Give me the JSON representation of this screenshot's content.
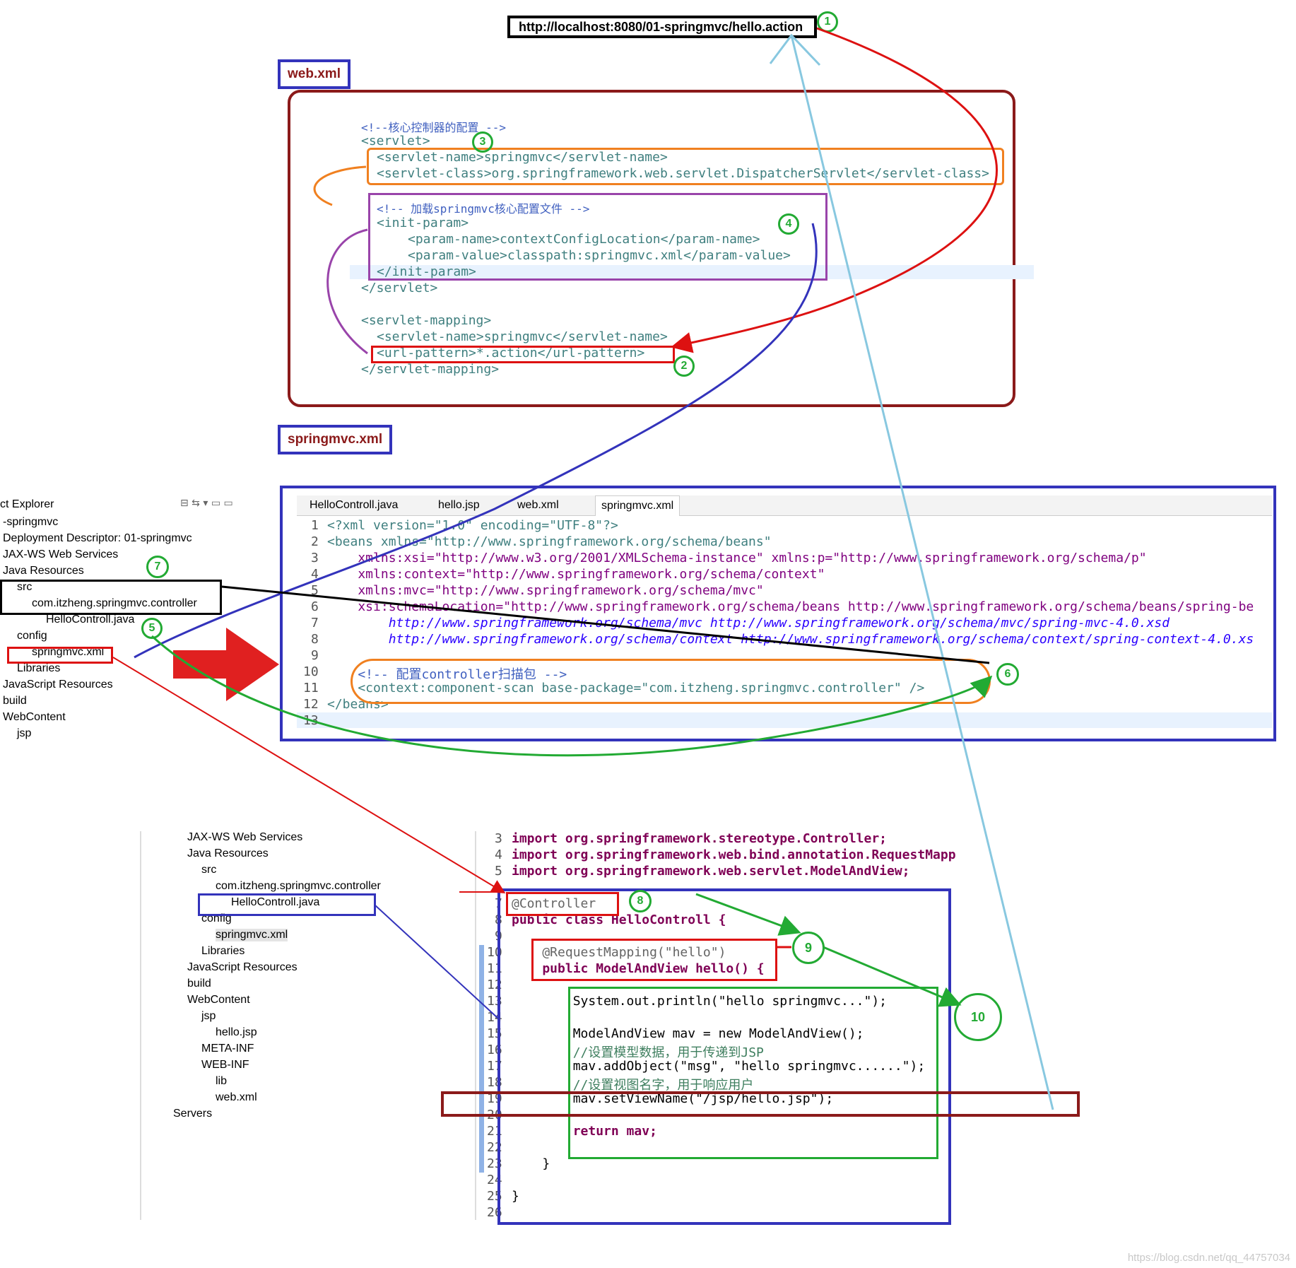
{
  "url": "http://localhost:8080/01-springmvc/hello.action",
  "labels": {
    "webxml": "web.xml",
    "springmvcxml": "springmvc.xml"
  },
  "steps": [
    "1",
    "2",
    "3",
    "4",
    "5",
    "6",
    "7",
    "8",
    "9",
    "10"
  ],
  "webxml_lines": [
    "<!--核心控制器的配置 -->",
    "<servlet>",
    "<servlet-name>springmvc</servlet-name>",
    "<servlet-class>org.springframework.web.servlet.DispatcherServlet</servlet-class>",
    "<!-- 加载springmvc核心配置文件 -->",
    "<init-param>",
    "<param-name>contextConfigLocation</param-name>",
    "<param-value>classpath:springmvc.xml</param-value>",
    "</init-param>",
    "</servlet>",
    "<servlet-mapping>",
    "<servlet-name>springmvc</servlet-name>",
    "<url-pattern>*.action</url-pattern>",
    "</servlet-mapping>"
  ],
  "explorer": {
    "title": "ct Explorer",
    "items": [
      "-springmvc",
      "Deployment Descriptor: 01-springmvc",
      "JAX-WS Web Services",
      "Java Resources",
      "src",
      "com.itzheng.springmvc.controller",
      "HelloControll.java",
      "config",
      "springmvc.xml",
      "Libraries",
      "JavaScript Resources",
      "build",
      "WebContent",
      "jsp"
    ]
  },
  "editor": {
    "tabs": [
      "HelloControll.java",
      "hello.jsp",
      "web.xml",
      "springmvc.xml"
    ],
    "line_numbers": [
      "1",
      "2",
      "3",
      "4",
      "5",
      "6",
      "7",
      "8",
      "9",
      "10",
      "11",
      "12",
      "13"
    ],
    "lines": [
      "<?xml version=\"1.0\" encoding=\"UTF-8\"?>",
      "<beans xmlns=\"http://www.springframework.org/schema/beans\"",
      "    xmlns:xsi=\"http://www.w3.org/2001/XMLSchema-instance\" xmlns:p=\"http://www.springframework.org/schema/p\"",
      "    xmlns:context=\"http://www.springframework.org/schema/context\"",
      "    xmlns:mvc=\"http://www.springframework.org/schema/mvc\"",
      "    xsi:schemaLocation=\"http://www.springframework.org/schema/beans http://www.springframework.org/schema/beans/spring-be",
      "        http://www.springframework.org/schema/mvc http://www.springframework.org/schema/mvc/spring-mvc-4.0.xsd",
      "        http://www.springframework.org/schema/context http://www.springframework.org/schema/context/spring-context-4.0.xs",
      "",
      "    <!-- 配置controller扫描包 -->",
      "    <context:component-scan base-package=\"com.itzheng.springmvc.controller\" />",
      "</beans>",
      ""
    ]
  },
  "tree2": [
    "JAX-WS Web Services",
    "Java Resources",
    "src",
    "com.itzheng.springmvc.controller",
    "HelloControll.java",
    "config",
    "springmvc.xml",
    "Libraries",
    "JavaScript Resources",
    "build",
    "WebContent",
    "jsp",
    "hello.jsp",
    "META-INF",
    "WEB-INF",
    "lib",
    "web.xml",
    "Servers"
  ],
  "java": {
    "line_numbers": [
      "3",
      "4",
      "5",
      "",
      "7",
      "8",
      "9",
      "10",
      "11",
      "12",
      "13",
      "14",
      "15",
      "16",
      "17",
      "18",
      "19",
      "20",
      "21",
      "22",
      "23",
      "24",
      "25",
      "26"
    ],
    "lines": [
      "import org.springframework.stereotype.Controller;",
      "import org.springframework.web.bind.annotation.RequestMapp",
      "import org.springframework.web.servlet.ModelAndView;",
      "",
      "@Controller",
      "public class HelloControll {",
      "",
      "    @RequestMapping(\"hello\")",
      "    public ModelAndView hello() {",
      "",
      "        System.out.println(\"hello springmvc...\");",
      "",
      "        ModelAndView mav = new ModelAndView();",
      "        //设置模型数据，用于传递到JSP",
      "        mav.addObject(\"msg\", \"hello springmvc......\");",
      "        //设置视图名字，用于响应用户",
      "        mav.setViewName(\"/jsp/hello.jsp\");",
      "",
      "        return mav;",
      "",
      "    }",
      "",
      "}",
      ""
    ]
  },
  "watermark": "https://blog.csdn.net/qq_44757034"
}
